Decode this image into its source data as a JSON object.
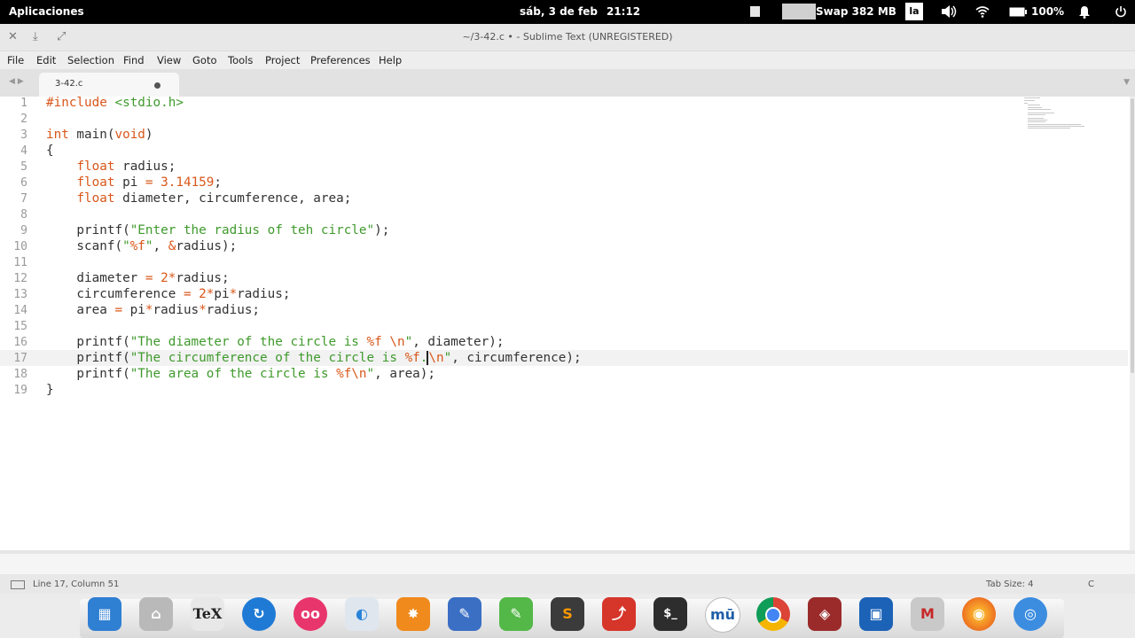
{
  "topbar": {
    "apps_label": "Aplicaciones",
    "date": "sáb, 3 de feb",
    "time": "21:12",
    "swap_label": "Swap 382 MB",
    "keyboard_layout": "la",
    "battery": "100%",
    "icons": [
      "window-icon",
      "volume-icon",
      "wifi-icon",
      "battery-icon",
      "bell-icon",
      "power-icon"
    ]
  },
  "window": {
    "title": "~/3-42.c • - Sublime Text (UNREGISTERED)",
    "buttons": [
      "close-icon",
      "minimize-icon",
      "maximize-icon"
    ]
  },
  "menu": {
    "items": [
      "File",
      "Edit",
      "Selection",
      "Find",
      "View",
      "Goto",
      "Tools",
      "Project",
      "Preferences",
      "Help"
    ]
  },
  "tab": {
    "filename": "3-42.c"
  },
  "editor": {
    "line_numbers": [
      "1",
      "2",
      "3",
      "4",
      "5",
      "6",
      "7",
      "8",
      "9",
      "10",
      "11",
      "12",
      "13",
      "14",
      "15",
      "16",
      "17",
      "18",
      "19"
    ],
    "current_line": 17
  },
  "statusbar": {
    "position": "Line 17, Column 51",
    "tab_size": "Tab Size: 4",
    "syntax": "C"
  },
  "dock": {
    "apps": [
      "file-manager-icon",
      "home-folder-icon",
      "texmaker-icon",
      "sync-icon",
      "flickr-icon",
      "toggle-settings-icon",
      "inkscape-icon",
      "text-editor-icon",
      "spreadsheet-icon",
      "sublime-text-icon",
      "pdf-reader-icon",
      "terminal-icon",
      "musescore-icon",
      "chrome-icon",
      "planner-icon",
      "virtualbox-icon",
      "math-tool-icon",
      "firefox-icon",
      "chromium-icon"
    ],
    "terminal_label": "$_",
    "musescore_label": "mū",
    "math_label": "M"
  },
  "colors": {
    "keyword": "#d9571a",
    "string": "#3f9a2c",
    "text": "#333333",
    "gutter": "#9a9a9a"
  }
}
